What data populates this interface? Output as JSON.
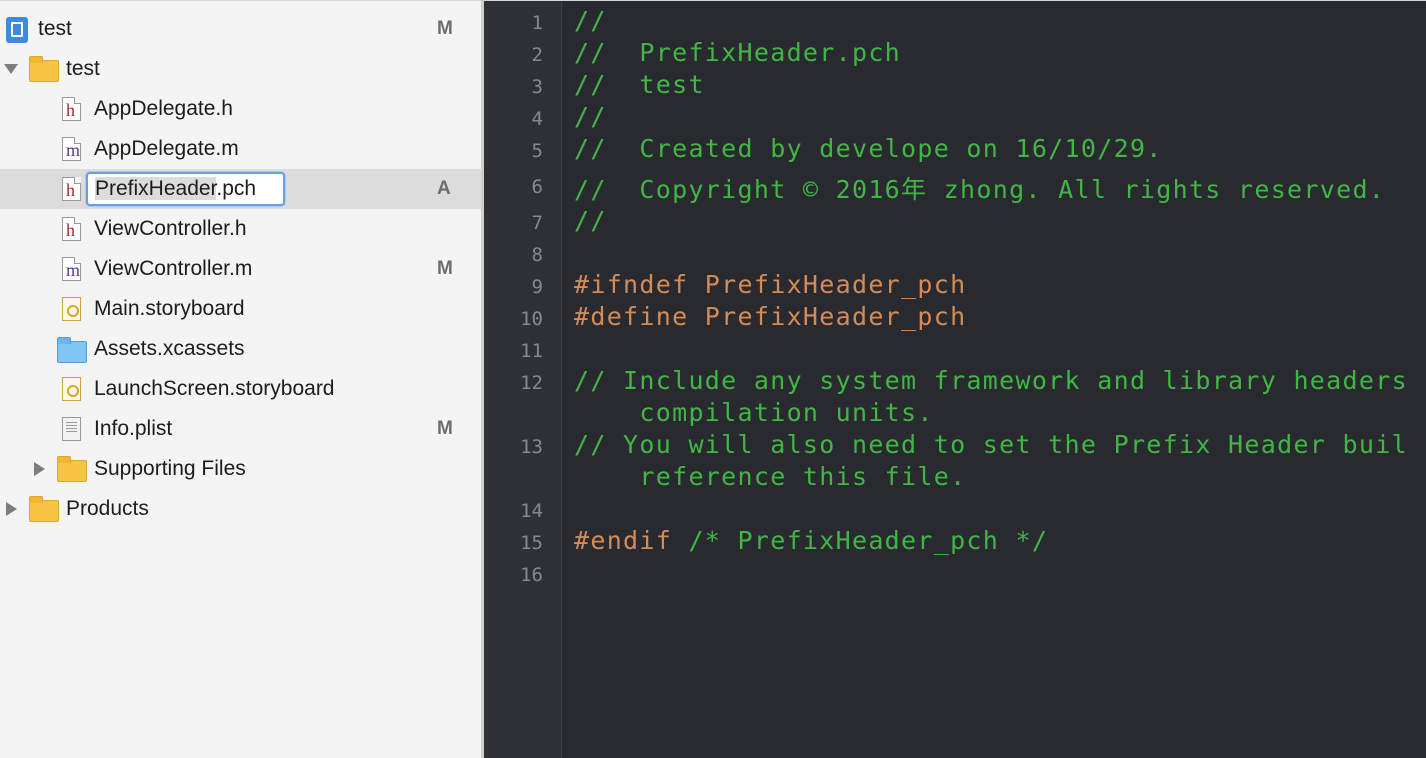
{
  "navigator": {
    "items": [
      {
        "label": "test",
        "status": "M",
        "icon": "project-icon"
      },
      {
        "label": "test",
        "status": "",
        "icon": "folder-icon"
      },
      {
        "label": "AppDelegate.h",
        "status": "",
        "icon": "header-file-icon",
        "letter": "h"
      },
      {
        "label": "AppDelegate.m",
        "status": "",
        "icon": "implementation-file-icon",
        "letter": "m"
      },
      {
        "label": "PrefixHeader.pch",
        "label_selected_part": "PrefixHeader",
        "label_rest": ".pch",
        "status": "A",
        "icon": "header-file-icon",
        "letter": "h"
      },
      {
        "label": "ViewController.h",
        "status": "",
        "icon": "header-file-icon",
        "letter": "h"
      },
      {
        "label": "ViewController.m",
        "status": "M",
        "icon": "implementation-file-icon",
        "letter": "m"
      },
      {
        "label": "Main.storyboard",
        "status": "",
        "icon": "storyboard-icon"
      },
      {
        "label": "Assets.xcassets",
        "status": "",
        "icon": "asset-catalog-icon"
      },
      {
        "label": "LaunchScreen.storyboard",
        "status": "",
        "icon": "storyboard-icon"
      },
      {
        "label": "Info.plist",
        "status": "M",
        "icon": "plist-icon"
      },
      {
        "label": "Supporting Files",
        "status": "",
        "icon": "folder-icon"
      },
      {
        "label": "Products",
        "status": "",
        "icon": "folder-icon"
      }
    ]
  },
  "editor": {
    "line_numbers": [
      "1",
      "2",
      "3",
      "4",
      "5",
      "6",
      "7",
      "8",
      "9",
      "10",
      "11",
      "12",
      "13",
      "14",
      "15",
      "16"
    ],
    "lines": [
      {
        "text": "//",
        "kind": "comment"
      },
      {
        "text": "//  PrefixHeader.pch",
        "kind": "comment"
      },
      {
        "text": "//  test",
        "kind": "comment"
      },
      {
        "text": "//",
        "kind": "comment"
      },
      {
        "text": "//  Created by develope on 16/10/29.",
        "kind": "comment"
      },
      {
        "text": "//  Copyright © 2016年 zhong. All rights reserved.",
        "kind": "comment"
      },
      {
        "text": "//",
        "kind": "comment"
      },
      {
        "text": "#ifndef PrefixHeader_pch",
        "kind": "preprocessor"
      },
      {
        "text": "#define PrefixHeader_pch",
        "kind": "preprocessor"
      },
      {
        "text": "// Include any system framework and library headers",
        "kind": "comment"
      },
      {
        "text": "    compilation units.",
        "kind": "comment"
      },
      {
        "text": "// You will also need to set the Prefix Header buil",
        "kind": "comment"
      },
      {
        "text": "    reference this file.",
        "kind": "comment"
      },
      {
        "text": "#endif",
        "kind": "preprocessor"
      },
      {
        "text": " /* PrefixHeader_pch */",
        "kind": "comment"
      }
    ]
  },
  "colors": {
    "comment": "#41b645",
    "preprocessor": "#d38b57",
    "editor_background": "#292a30",
    "gutter_background": "#2e3036",
    "selection": "#dcdcdc",
    "rename_border": "#6aa0dd"
  }
}
